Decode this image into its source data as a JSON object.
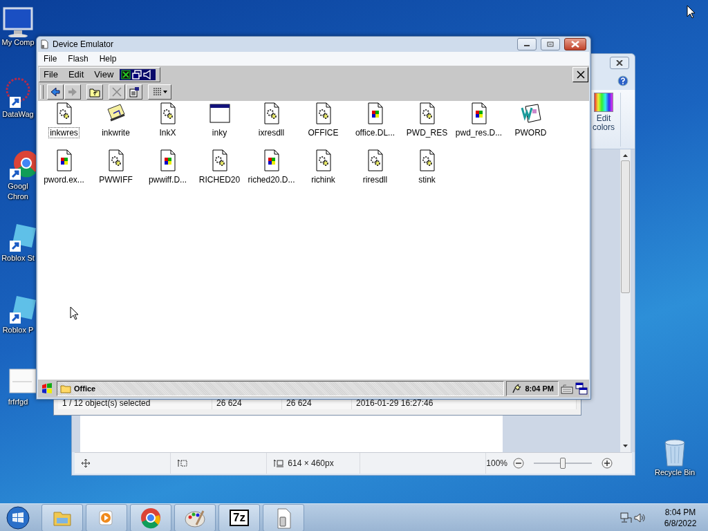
{
  "desktop_icons": [
    {
      "label": "My Comp",
      "kind": "computer"
    },
    {
      "label": "DataWag",
      "kind": "shortcut"
    },
    {
      "label": "Googl Chron",
      "kind": "chrome"
    },
    {
      "label": "Roblox St",
      "kind": "roblox"
    },
    {
      "label": "Roblox P",
      "kind": "roblox"
    },
    {
      "label": "frfrfgd",
      "kind": "thumbnail"
    }
  ],
  "recycle_bin": {
    "label": "Recycle Bin"
  },
  "paint_window": {
    "ribbon_button": "Edit colors",
    "status": {
      "dimensions": "614 × 460px",
      "zoom": "100%",
      "zoom_slider": {
        "level": 0.5
      }
    }
  },
  "archive_window": {
    "status_cells": [
      "1 / 12 object(s) selected",
      "26 624",
      "26 624",
      "2016-01-29 16:27:46"
    ]
  },
  "emulator": {
    "title": "Device Emulator",
    "menu": [
      "File",
      "Flash",
      "Help"
    ],
    "device": {
      "menu": [
        "File",
        "Edit",
        "View"
      ],
      "files": [
        {
          "name": "inkwres",
          "kind": "gear",
          "selected": true
        },
        {
          "name": "inkwrite",
          "kind": "scroll",
          "selected": false
        },
        {
          "name": "InkX",
          "kind": "gear",
          "selected": false
        },
        {
          "name": "inky",
          "kind": "window",
          "selected": false
        },
        {
          "name": "ixresdll",
          "kind": "gear",
          "selected": false
        },
        {
          "name": "OFFICE",
          "kind": "gear",
          "selected": false
        },
        {
          "name": "office.DL...",
          "kind": "exe",
          "selected": false
        },
        {
          "name": "PWD_RES",
          "kind": "gear",
          "selected": false
        },
        {
          "name": "pwd_res.D...",
          "kind": "exe",
          "selected": false
        },
        {
          "name": "PWORD",
          "kind": "word",
          "selected": false
        },
        {
          "name": "pword.ex...",
          "kind": "exe",
          "selected": false
        },
        {
          "name": "PWWIFF",
          "kind": "gear",
          "selected": false
        },
        {
          "name": "pwwiff.D...",
          "kind": "exe",
          "selected": false
        },
        {
          "name": "RICHED20",
          "kind": "gear",
          "selected": false
        },
        {
          "name": "riched20.D...",
          "kind": "exe",
          "selected": false
        },
        {
          "name": "richink",
          "kind": "gear",
          "selected": false
        },
        {
          "name": "riresdll",
          "kind": "gear",
          "selected": false
        },
        {
          "name": "stink",
          "kind": "gear",
          "selected": false
        }
      ],
      "taskbar": {
        "folder": "Office",
        "time": "8:04 PM"
      }
    }
  },
  "taskbar": {
    "apps": [
      {
        "kind": "explorer"
      },
      {
        "kind": "media"
      },
      {
        "kind": "chrome"
      },
      {
        "kind": "paint"
      },
      {
        "kind": "archiver",
        "label": "7z"
      },
      {
        "kind": "emulator"
      }
    ],
    "time": "8:04 PM",
    "date": "6/8/2022"
  }
}
